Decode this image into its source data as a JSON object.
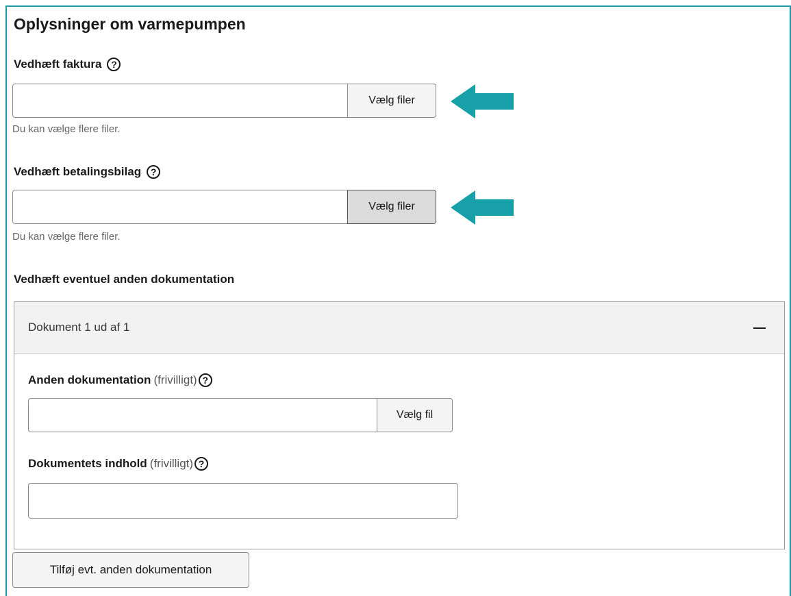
{
  "section_title": "Oplysninger om varmepumpen",
  "help_symbol": "?",
  "invoice": {
    "label": "Vedhæft faktura",
    "button": "Vælg filer",
    "hint": "Du kan vælge flere filer."
  },
  "payment": {
    "label": "Vedhæft betalingsbilag",
    "button": "Vælg filer",
    "hint": "Du kan vælge flere filer."
  },
  "other_docs": {
    "label": "Vedhæft eventuel anden dokumentation",
    "panel_title": "Dokument 1 ud af 1",
    "other_label": "Anden dokumentation",
    "other_optional": "(frivilligt)",
    "other_button": "Vælg fil",
    "content_label": "Dokumentets indhold",
    "content_optional": "(frivilligt)",
    "add_button": "Tilføj evt. anden dokumentation"
  },
  "colors": {
    "accent": "#1a9aa8",
    "arrow": "#17a0a8"
  },
  "icons": {
    "help": "help-circle-icon",
    "arrow": "arrow-left-icon",
    "collapse": "minus-icon"
  }
}
